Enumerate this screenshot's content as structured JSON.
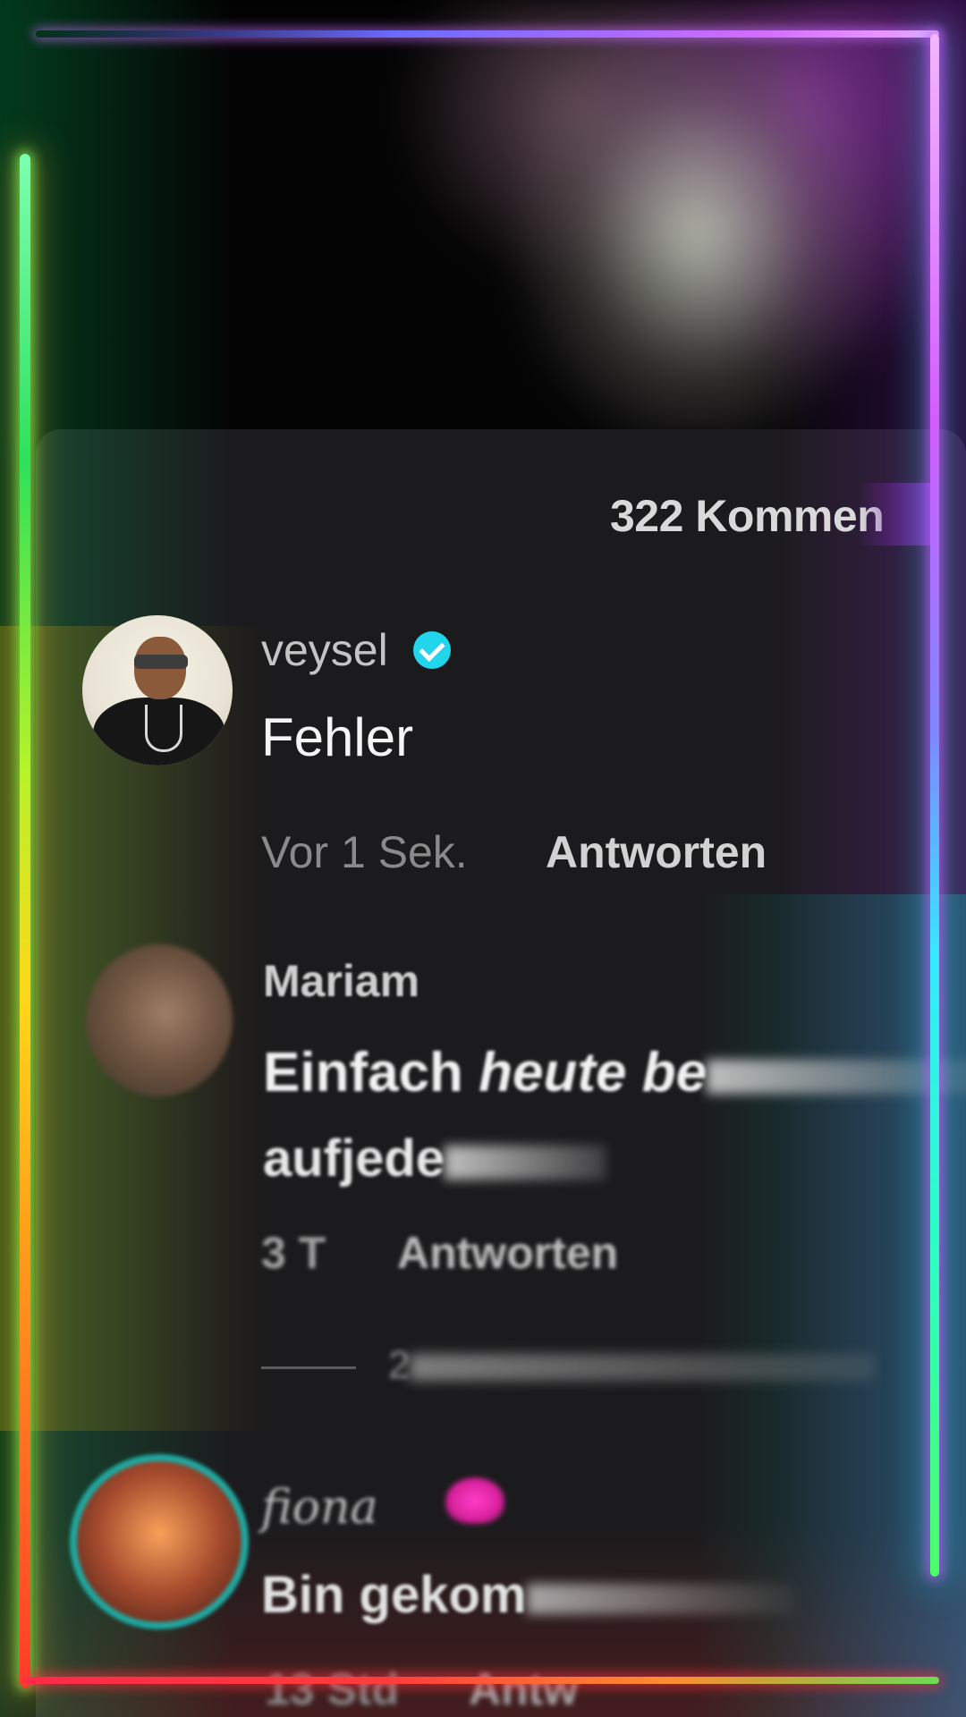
{
  "header": {
    "comment_count_label": "322 Kommen"
  },
  "comments": [
    {
      "username": "veysel",
      "verified": true,
      "text": "Fehler",
      "time": "Vor 1 Sek.",
      "reply_label": "Antworten",
      "avatar_icon": "profile-photo"
    },
    {
      "username": "Mariam",
      "text_line1_regular": "Einfach ",
      "text_line1_italic": "heute be",
      "text_line2": "aufjede",
      "time": "3 T",
      "reply_label": "Antworten",
      "replies_label": "2",
      "avatar_icon": "profile-photo"
    },
    {
      "username": "fiona",
      "emoji_icon": "pink-heart-icon",
      "text": "Bin gekom",
      "time": "13 Std",
      "reply_label": "Antw",
      "avatar_icon": "profile-photo"
    }
  ],
  "colors": {
    "sheet_background": "#1b1b1d",
    "verified_badge": "#20d5ec",
    "neon_left": "#2fe05a",
    "neon_right": "#d35cff",
    "neon_bottom": "#ff2a4a"
  }
}
